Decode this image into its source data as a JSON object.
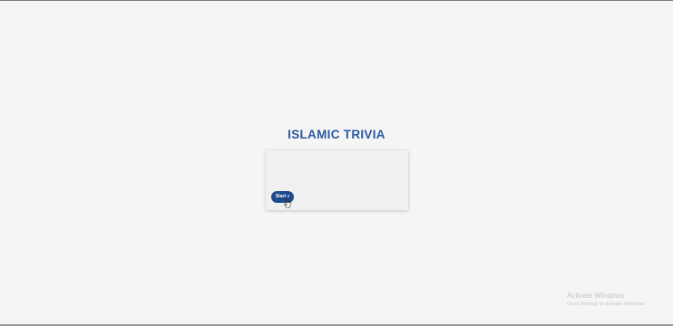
{
  "page": {
    "title": "ISLAMIC TRIVIA",
    "background": "#f6f5f6",
    "title_color": "#2a5a9f"
  },
  "quiz_card": {
    "start_label": "Start »",
    "button_color": "#1e4b8c"
  },
  "cursor": {
    "icon": "hand-pointer-icon"
  },
  "watermark": {
    "title": "Activate Windows",
    "subtitle": "Go to Settings to activate Windows."
  }
}
